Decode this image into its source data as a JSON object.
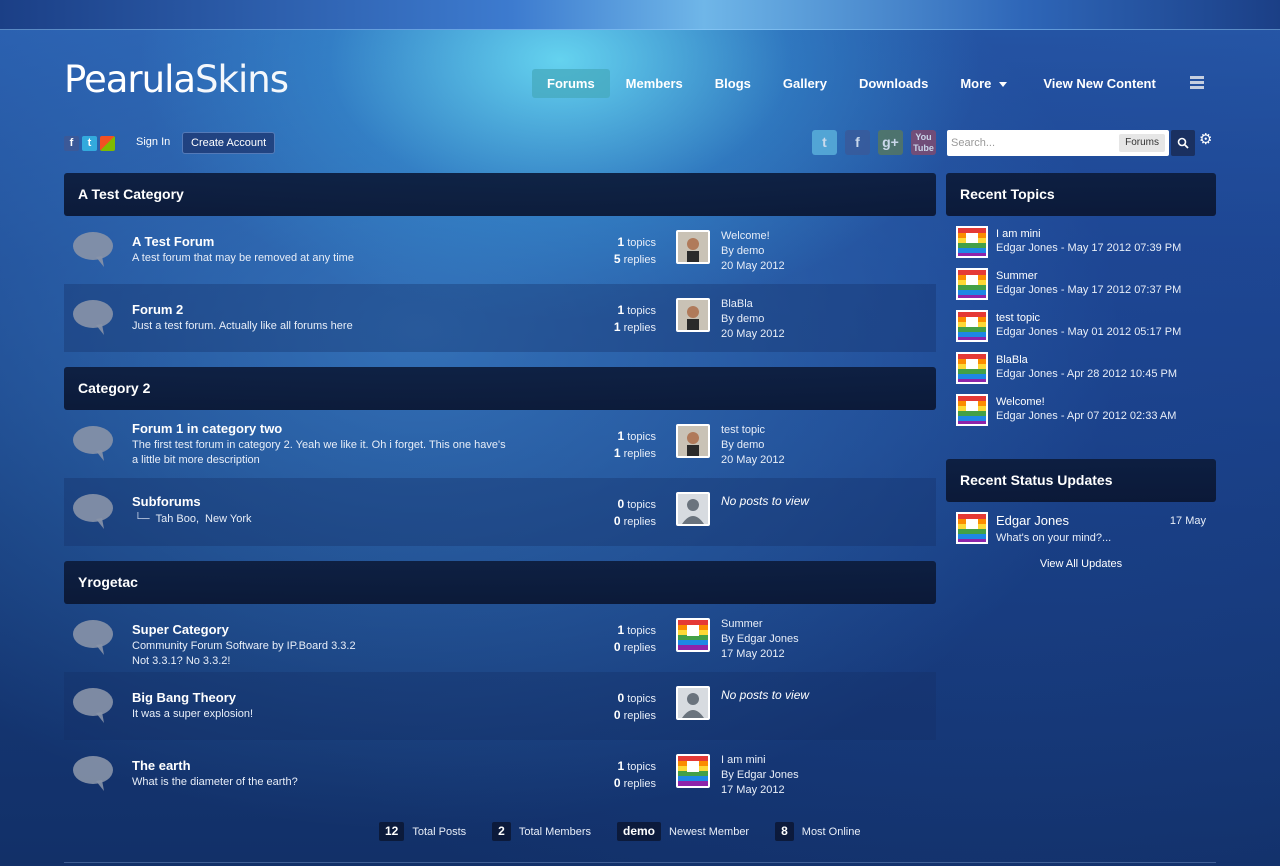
{
  "header": {
    "logo_bold": "Pearula",
    "logo_thin": "Skins",
    "nav": [
      "Forums",
      "Members",
      "Blogs",
      "Gallery",
      "Downloads",
      "More",
      "View New Content"
    ],
    "sign_in": "Sign In",
    "create_account": "Create Account",
    "search_placeholder": "Search...",
    "search_scope": "Forums"
  },
  "categories": [
    {
      "title": "A Test Category",
      "forums": [
        {
          "title": "A Test Forum",
          "desc": "A test forum that may be removed at any time",
          "topics": "1",
          "replies": "5",
          "lp_title": "Welcome!",
          "lp_by": "By demo",
          "lp_date": "20 May 2012"
        },
        {
          "title": "Forum 2",
          "desc": "Just a test forum. Actually like all forums here",
          "topics": "1",
          "replies": "1",
          "lp_title": "BlaBla",
          "lp_by": "By demo",
          "lp_date": "20 May 2012"
        }
      ]
    },
    {
      "title": "Category 2",
      "forums": [
        {
          "title": "Forum 1 in category two",
          "desc": "The first test forum in category 2. Yeah we like it. Oh i forget. This one have's a little bit more description",
          "topics": "1",
          "replies": "1",
          "lp_title": "test topic",
          "lp_by": "By demo",
          "lp_date": "20 May 2012"
        },
        {
          "title": "Subforums",
          "subforums": [
            "Tah Boo",
            "New York"
          ],
          "topics": "0",
          "replies": "0",
          "no_posts": "No posts to view"
        }
      ]
    },
    {
      "title": "Yrogetac",
      "forums": [
        {
          "title": "Super Category",
          "desc": "Community Forum Software by IP.Board 3.3.2",
          "desc2": "Not 3.3.1? No 3.3.2!",
          "topics": "1",
          "replies": "0",
          "lp_title": "Summer",
          "lp_by": "By Edgar Jones",
          "lp_date": "17 May 2012"
        },
        {
          "title": "Big Bang Theory",
          "desc": "It was a super explosion!",
          "topics": "0",
          "replies": "0",
          "no_posts": "No posts to view"
        },
        {
          "title": "The earth",
          "desc": "What is the diameter of the earth?",
          "topics": "1",
          "replies": "0",
          "lp_title": "I am mini",
          "lp_by": "By Edgar Jones",
          "lp_date": "17 May 2012"
        }
      ]
    }
  ],
  "labels": {
    "topics": "topics",
    "replies": "replies"
  },
  "sidebar": {
    "recent_topics_title": "Recent Topics",
    "recent_topics": [
      {
        "title": "I am mini",
        "meta": "Edgar Jones - May 17 2012 07:39 PM"
      },
      {
        "title": "Summer",
        "meta": "Edgar Jones - May 17 2012 07:37 PM"
      },
      {
        "title": "test topic",
        "meta": "Edgar Jones - May 01 2012 05:17 PM"
      },
      {
        "title": "BlaBla",
        "meta": "Edgar Jones - Apr 28 2012 10:45 PM"
      },
      {
        "title": "Welcome!",
        "meta": "Edgar Jones - Apr 07 2012 02:33 AM"
      }
    ],
    "status_title": "Recent Status Updates",
    "status_name": "Edgar Jones",
    "status_date": "17 May",
    "status_text": "What's on your mind?...",
    "view_all": "View All Updates"
  },
  "board_stats": [
    {
      "num": "12",
      "label": "Total Posts"
    },
    {
      "num": "2",
      "label": "Total Members"
    },
    {
      "num": "demo",
      "label": "Newest Member"
    },
    {
      "num": "8",
      "label": "Most Online"
    }
  ],
  "colors": {
    "accent": "#46aabe",
    "header_dark": "#0c1c3c"
  }
}
